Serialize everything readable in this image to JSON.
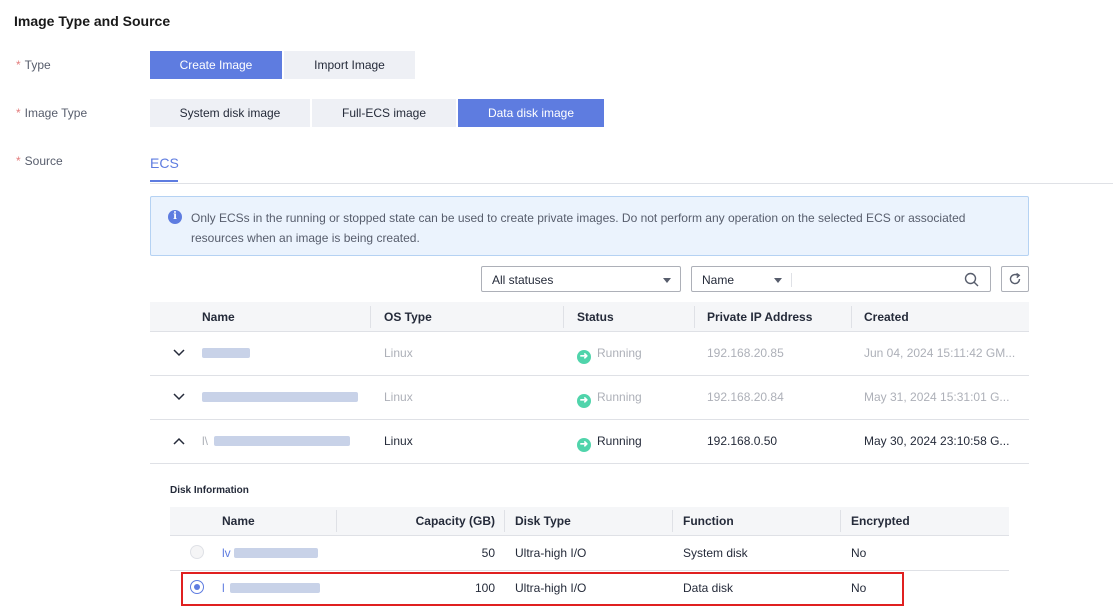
{
  "section_title": "Image Type and Source",
  "labels": {
    "type": "Type",
    "image_type": "Image Type",
    "source": "Source",
    "required_mark": "*"
  },
  "type_options": [
    "Create Image",
    "Import Image"
  ],
  "image_type_options": [
    "System disk image",
    "Full-ECS image",
    "Data disk image"
  ],
  "source_tab": "ECS",
  "info_text": "Only ECSs in the running or stopped state can be used to create private images. Do not perform any operation on the selected ECS or associated resources when an image is being created.",
  "filters": {
    "status_select": "All statuses",
    "field_select": "Name",
    "search_value": ""
  },
  "ecs_table": {
    "headers": [
      "Name",
      "OS Type",
      "Status",
      "Private IP Address",
      "Created"
    ],
    "rows": [
      {
        "name": "",
        "os": "Linux",
        "status": "Running",
        "ip": "192.168.20.85",
        "created": "Jun 04, 2024 15:11:42 GM..."
      },
      {
        "name": "",
        "os": "Linux",
        "status": "Running",
        "ip": "192.168.20.84",
        "created": "May 31, 2024 15:31:01 G..."
      },
      {
        "name": "l\\",
        "os": "Linux",
        "status": "Running",
        "ip": "192.168.0.50",
        "created": "May 30, 2024 23:10:58 G..."
      }
    ]
  },
  "disk_info": {
    "title": "Disk Information",
    "headers": [
      "Name",
      "Capacity (GB)",
      "Disk Type",
      "Function",
      "Encrypted"
    ],
    "rows": [
      {
        "name": "lv",
        "capacity": "50",
        "disk_type": "Ultra-high I/O",
        "function": "System disk",
        "encrypted": "No",
        "selected": false
      },
      {
        "name": "l",
        "capacity": "100",
        "disk_type": "Ultra-high I/O",
        "function": "Data disk",
        "encrypted": "No",
        "selected": true
      }
    ]
  },
  "colors": {
    "accent": "#5e7ce0",
    "running": "#50d4ab",
    "highlight_border": "#e02020"
  }
}
